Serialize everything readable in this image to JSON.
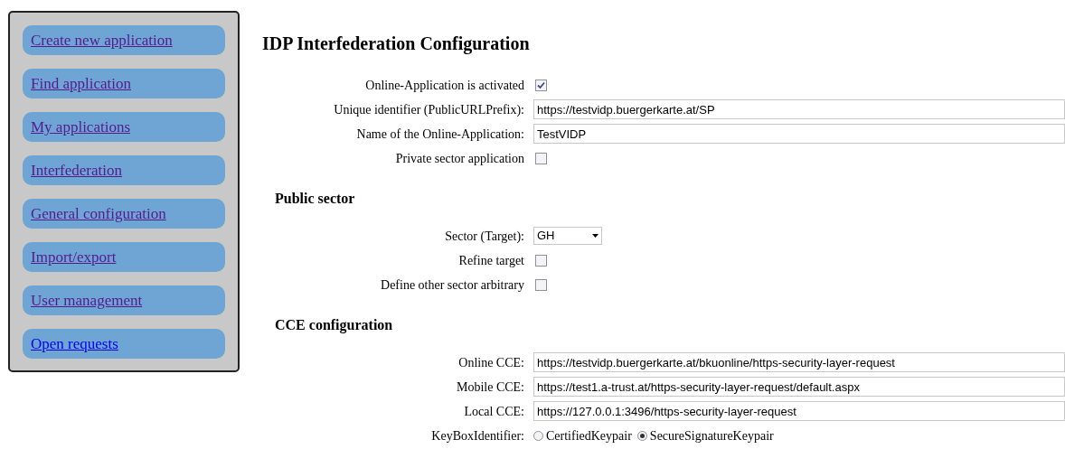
{
  "nav": [
    {
      "label": "Create new application",
      "visited": true
    },
    {
      "label": "Find application",
      "visited": true
    },
    {
      "label": "My applications",
      "visited": true
    },
    {
      "label": "Interfederation",
      "visited": true
    },
    {
      "label": "General configuration",
      "visited": true
    },
    {
      "label": "Import/export",
      "visited": true
    },
    {
      "label": "User management",
      "visited": true
    },
    {
      "label": "Open requests",
      "visited": false
    }
  ],
  "title": "IDP Interfederation Configuration",
  "fields": [
    {
      "kind": "checkbox",
      "label": "Online-Application is activated",
      "checked": true
    },
    {
      "kind": "text",
      "label": "Unique identifier (PublicURLPrefix):",
      "value": "https://testvidp.buergerkarte.at/SP"
    },
    {
      "kind": "text",
      "label": "Name of the Online-Application:",
      "value": "TestVIDP"
    },
    {
      "kind": "checkbox",
      "label": "Private sector application",
      "checked": false
    }
  ],
  "sections": [
    {
      "heading": "Public sector",
      "fields": [
        {
          "kind": "select",
          "label": "Sector (Target):",
          "value": "GH"
        },
        {
          "kind": "checkbox",
          "label": "Refine target",
          "checked": false
        },
        {
          "kind": "checkbox",
          "label": "Define other sector arbitrary",
          "checked": false
        }
      ]
    },
    {
      "heading": "CCE configuration",
      "fields": [
        {
          "kind": "text",
          "label": "Online CCE:",
          "value": "https://testvidp.buergerkarte.at/bkuonline/https-security-layer-request"
        },
        {
          "kind": "text",
          "label": "Mobile CCE:",
          "value": "https://test1.a-trust.at/https-security-layer-request/default.aspx"
        },
        {
          "kind": "text",
          "label": "Local CCE:",
          "value": "https://127.0.0.1:3496/https-security-layer-request"
        },
        {
          "kind": "radio",
          "label": "KeyBoxIdentifier:",
          "options": [
            {
              "label": "CertifiedKeypair",
              "selected": false
            },
            {
              "label": "SecureSignatureKeypair",
              "selected": true
            }
          ]
        }
      ]
    }
  ]
}
